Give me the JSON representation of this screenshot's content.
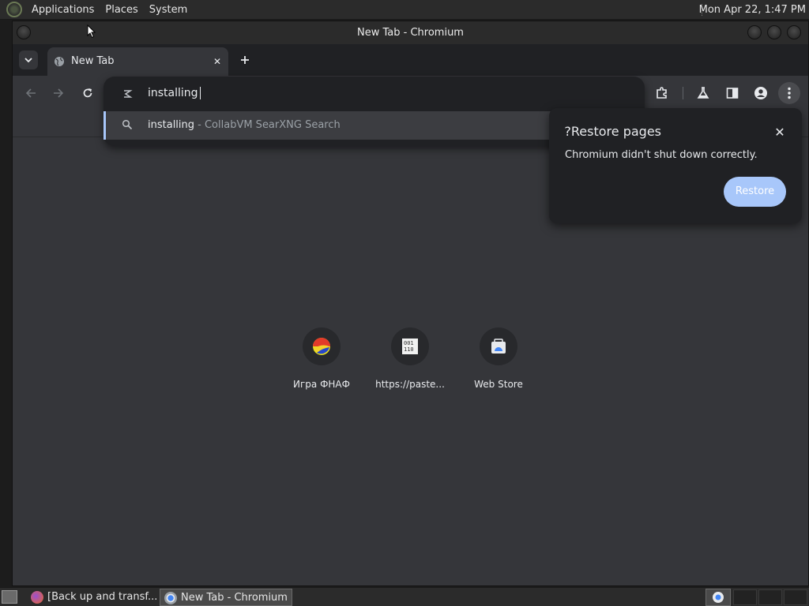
{
  "top_panel": {
    "menus": [
      "Applications",
      "Places",
      "System"
    ],
    "clock": "Mon Apr 22,  1:47 PM"
  },
  "window": {
    "title": "New Tab - Chromium"
  },
  "tabs": [
    {
      "label": "New Tab",
      "active": true
    }
  ],
  "omnibox": {
    "text": "installing",
    "suggestions": [
      {
        "query": "installing",
        "description": " - CollabVM SearXNG Search"
      }
    ]
  },
  "restore_bubble": {
    "title": "Restore pages?",
    "message": "Chromium didn't shut down correctly.",
    "restore_label": "Restore"
  },
  "shortcuts": [
    {
      "title": "Игра ФНАФ",
      "icon": "fnaf-icon"
    },
    {
      "title": "https://paste...",
      "icon": "binary-document-icon"
    },
    {
      "title": "Web Store",
      "icon": "web-store-icon"
    }
  ],
  "taskbar": {
    "items": [
      {
        "label": "[Back up and transf...",
        "icon": "firefox-icon"
      },
      {
        "label": "New Tab - Chromium",
        "icon": "chromium-icon",
        "active": true
      }
    ]
  },
  "colors": {
    "accent": "#a8c7fa",
    "page_bg": "#35363a",
    "popup_bg": "#202124"
  }
}
